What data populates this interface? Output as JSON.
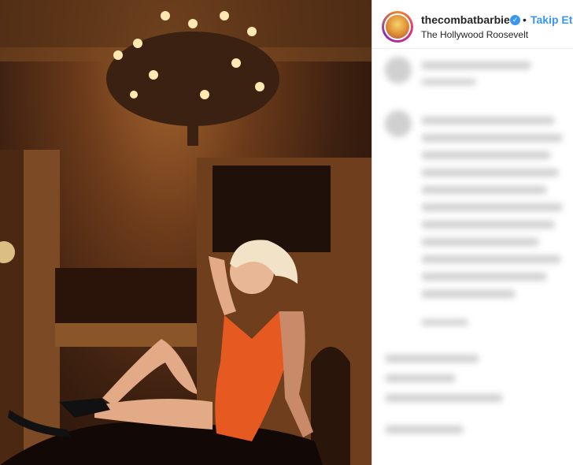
{
  "post": {
    "photo_description": "",
    "account": {
      "username": "thecombatbarbie",
      "verified_icon": "verified-badge-icon",
      "separator": "•",
      "follow_label": "Takip Et",
      "location": "The Hollywood Roosevelt"
    },
    "colors": {
      "follow": "#3897f0",
      "verified": "#3897f0",
      "username": "#262626"
    }
  }
}
